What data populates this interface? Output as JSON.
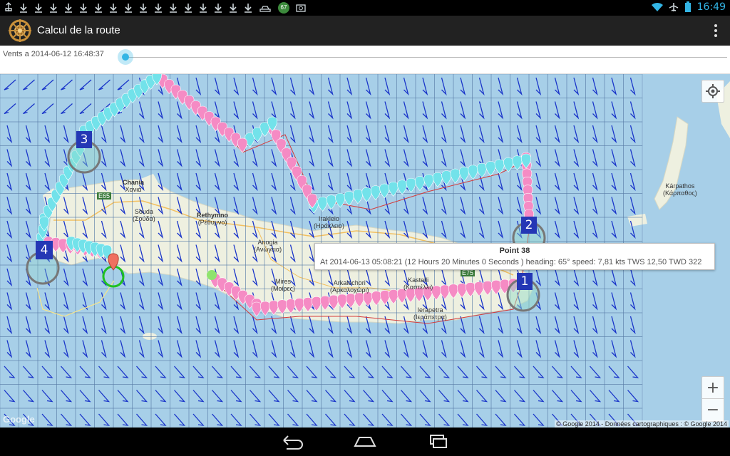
{
  "status_bar": {
    "clock": "16:49",
    "notification_badge": "67",
    "icons": [
      "usb-icon",
      "download-icon",
      "car-icon",
      "notification-badge",
      "camera-icon",
      "wifi-icon",
      "airplane-icon",
      "battery-icon"
    ]
  },
  "action_bar": {
    "title": "Calcul de la route",
    "icon": "ships-wheel-icon",
    "overflow": "overflow-menu-icon"
  },
  "wind_bar": {
    "label": "Vents a 2014-06-12 16:48:37"
  },
  "map": {
    "places": [
      {
        "name": "Chania",
        "greek": "Χανιά"
      },
      {
        "name": "Rethymno",
        "greek": "(Ρέθυμνο)"
      },
      {
        "name": "Anogia",
        "greek": "(Ανώγεια)"
      },
      {
        "name": "Mires",
        "greek": "(Μοίρες)"
      },
      {
        "name": "Arkalochori",
        "greek": "(Αρκαλοχώρι)"
      },
      {
        "name": "Kastelli",
        "greek": "(Καστέλλι)"
      },
      {
        "name": "Ierapetra",
        "greek": "(Ιεράπετρα)"
      },
      {
        "name": "Kárpathos",
        "greek": "(Κάρπαθος)"
      },
      {
        "name": "Irakleio",
        "greek": "(Ηράκλειο)"
      },
      {
        "name": "Souda",
        "greek": "(Σούδα)"
      }
    ],
    "waypoints": [
      "1",
      "2",
      "3",
      "4"
    ],
    "road_label": "E75",
    "road_label_2": "E65",
    "attribution": "© Google 2014 - Données cartographiques : © Google 2014",
    "logo": "Google",
    "zoom_in": "+",
    "zoom_out": "−"
  },
  "tooltip": {
    "title": "Point 38",
    "detail": "At 2014-06-13 05:08:21 (12 Hours 20 Minutes 0 Seconds ) heading: 65° speed: 7,81 kts TWS 12,50 TWD 322"
  },
  "colors": {
    "sea": "#a7cfe8",
    "land": "#eef0e0",
    "wind_arrow": "#1a35c9",
    "route_pink": "#f58bc4",
    "route_cyan": "#72e2ea",
    "waypoint": "#2437b5",
    "accent": "#33b5e5"
  }
}
